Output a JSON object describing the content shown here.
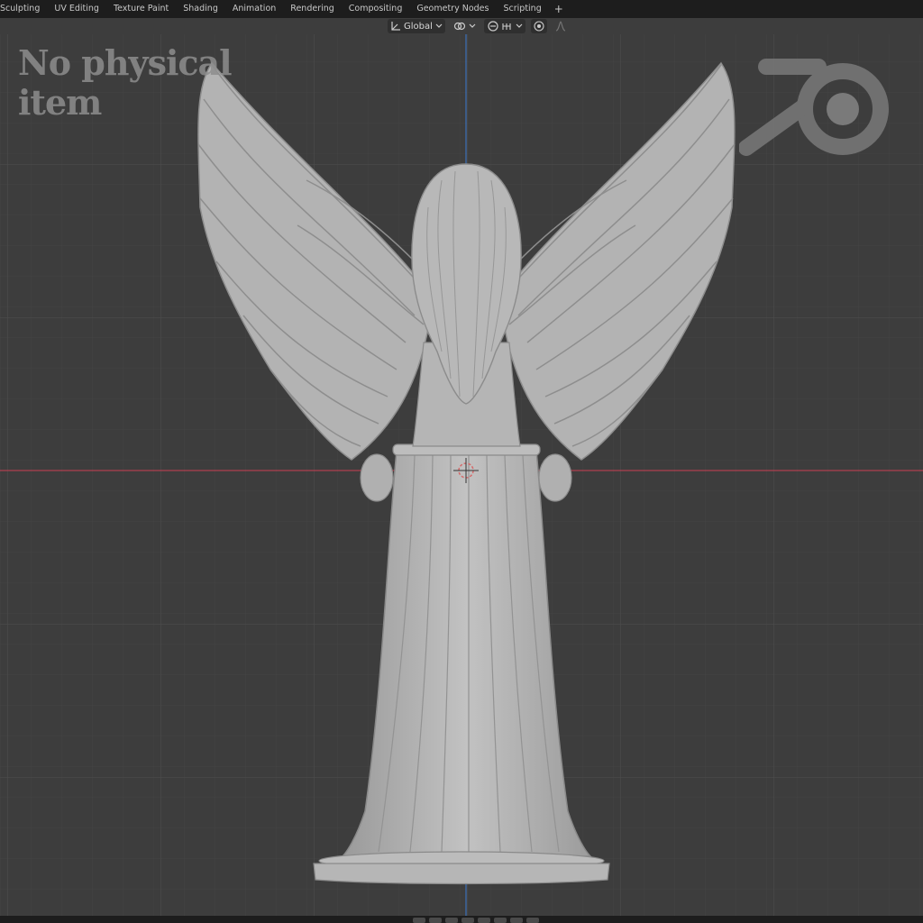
{
  "workspace_tabs": [
    "Sculpting",
    "UV Editing",
    "Texture Paint",
    "Shading",
    "Animation",
    "Rendering",
    "Compositing",
    "Geometry Nodes",
    "Scripting"
  ],
  "add_workspace_label": "+",
  "header": {
    "orientation_label": "Global",
    "orientation_icon": "transform-orientation-icon",
    "pivot_icon": "pivot-point-icon",
    "snap_icon": "snap-icon",
    "proportional_icon": "proportional-editing-icon",
    "falloff_icon": "falloff-icon"
  },
  "watermark": {
    "line1": "No physical",
    "line2": "item"
  },
  "colors": {
    "topbar_bg": "#1d1d1d",
    "viewport_bg": "#3d3d3d",
    "grid_line": "#4a4a4a",
    "x_axis": "#b04050",
    "z_axis": "#3d70b8",
    "model": "#b4b4b4"
  }
}
